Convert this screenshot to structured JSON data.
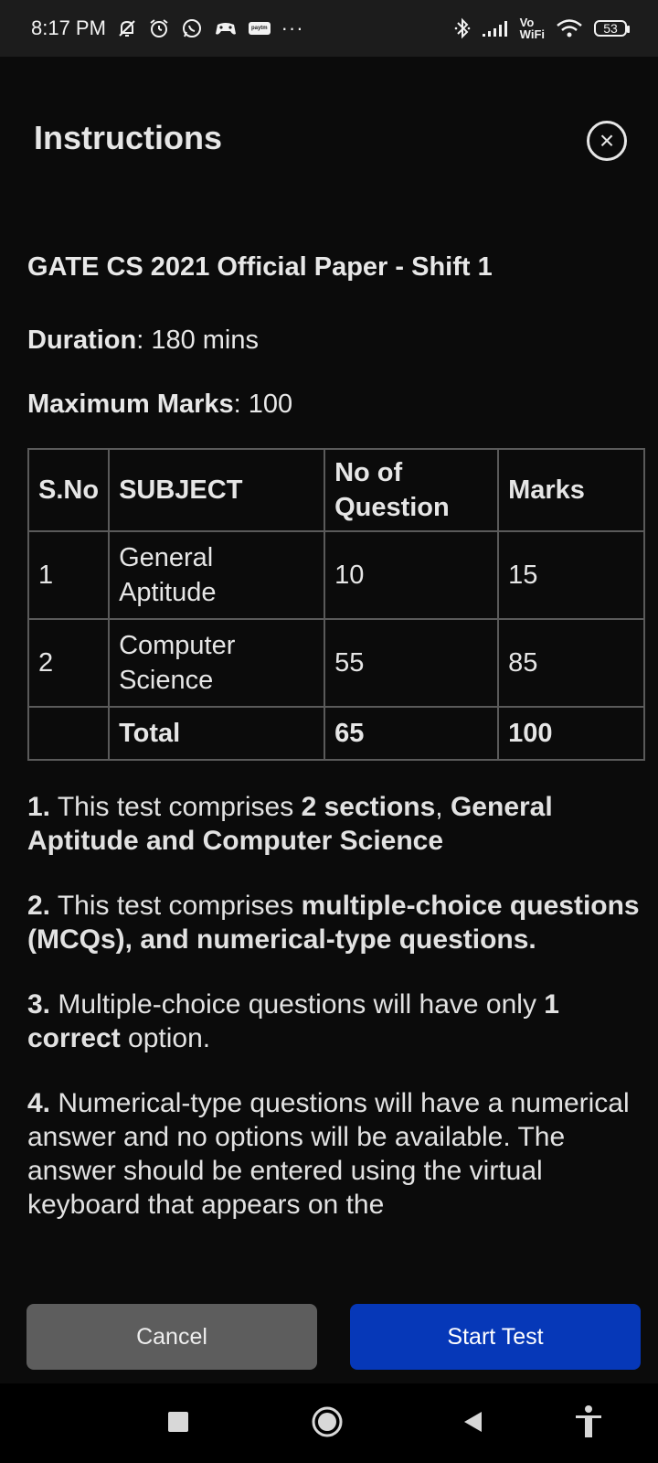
{
  "status_bar": {
    "time": "8:17 PM",
    "vo_top": "Vo",
    "vo_bottom": "WiFi",
    "battery": "53",
    "paytm_label": "paytm",
    "icons": [
      "mute-bell-icon",
      "alarm-icon",
      "whatsapp-icon",
      "game-icon",
      "paytm-icon",
      "more-icon",
      "bluetooth-icon",
      "signal-icon",
      "wifi-icon",
      "battery-icon"
    ]
  },
  "header": {
    "title": "Instructions",
    "close_icon": "×"
  },
  "test": {
    "name": "GATE CS 2021 Official Paper - Shift 1",
    "duration_label": "Duration",
    "duration_value": ": 180 mins",
    "max_marks_label": "Maximum Marks",
    "max_marks_value": ": 100"
  },
  "table": {
    "headers": [
      "S.No",
      "SUBJECT",
      "No of Question",
      "Marks"
    ],
    "rows": [
      {
        "sno": "1",
        "subject": "General Aptitude",
        "questions": "10",
        "marks": "15"
      },
      {
        "sno": "2",
        "subject": "Computer Science",
        "questions": "55",
        "marks": "85"
      }
    ],
    "total": {
      "sno": "",
      "label": "Total",
      "questions": "65",
      "marks": "100"
    }
  },
  "rules": [
    {
      "num": "1.",
      "t1": " This test comprises ",
      "b1": "2 sections",
      "t2": ", ",
      "b2": "General Aptitude and Computer Science",
      "t3": ""
    },
    {
      "num": "2.",
      "t1": " This test comprises ",
      "b1": "multiple-choice questions (MCQs), and numerical-type questions.",
      "t2": "",
      "b2": "",
      "t3": ""
    },
    {
      "num": "3.",
      "t1": " Multiple-choice questions will have only ",
      "b1": "1 correct",
      "t2": " option.",
      "b2": "",
      "t3": ""
    },
    {
      "num": "4.",
      "t1": " Numerical-type questions will have a numerical answer and no options will be available. The answer should be entered using the virtual keyboard that appears on the",
      "b1": "",
      "t2": "",
      "b2": "",
      "t3": ""
    }
  ],
  "buttons": {
    "cancel": "Cancel",
    "start": "Start Test"
  },
  "colors": {
    "background": "#0b0b0b",
    "start_button": "#0638b8",
    "cancel_button": "#5d5d5d"
  }
}
